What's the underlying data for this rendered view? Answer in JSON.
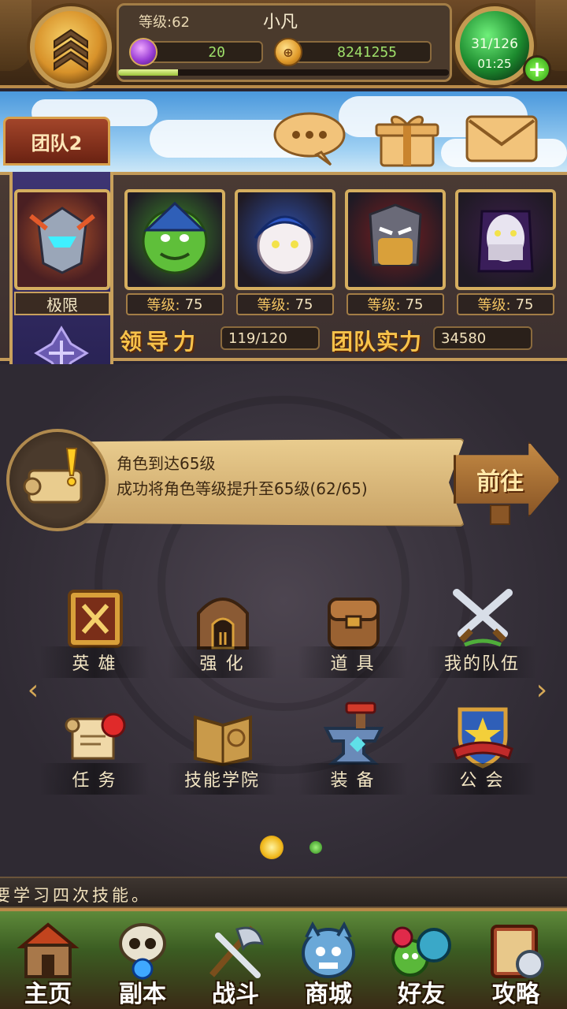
{
  "hud": {
    "level_label": "等级:62",
    "player_name": "小凡",
    "gems": "20",
    "gold": "8241255",
    "gold_icon_glyph": "⊕",
    "exp_fraction": 0.18,
    "energy": "31/126",
    "energy_timer": "01:25",
    "add_glyph": "+"
  },
  "team": {
    "tab_label": "团队2",
    "leader_tag": "极限",
    "heroes": [
      {
        "level_label": "等级:",
        "level": "75",
        "color": "#3c8b2a"
      },
      {
        "level_label": "等级:",
        "level": "75",
        "color": "#2f4fa8"
      },
      {
        "level_label": "等级:",
        "level": "75",
        "color": "#7a1f1f"
      },
      {
        "level_label": "等级:",
        "level": "75",
        "color": "#3b1e4a"
      }
    ],
    "leadership_label": "领导力",
    "leadership_value": "119/120",
    "power_label": "团队实力",
    "power_value": "34580"
  },
  "quest": {
    "title": "角色到达65级",
    "desc": "成功将角色等级提升至65级(62/65)",
    "go_label": "前往"
  },
  "menu": [
    {
      "label": "英 雄",
      "icon": "hero-book-icon"
    },
    {
      "label": "强 化",
      "icon": "forge-icon"
    },
    {
      "label": "道 具",
      "icon": "backpack-icon"
    },
    {
      "label": "我的队伍",
      "icon": "crossed-swords-icon"
    },
    {
      "label": "任 务",
      "icon": "scroll-icon"
    },
    {
      "label": "技能学院",
      "icon": "spellbook-icon"
    },
    {
      "label": "装 备",
      "icon": "anvil-icon"
    },
    {
      "label": "公 会",
      "icon": "guild-shield-icon"
    }
  ],
  "arrows": {
    "left": "‹",
    "right": "›"
  },
  "ticker": "要学习四次技能。",
  "nav": [
    {
      "label": "主页",
      "icon": "home-icon"
    },
    {
      "label": "副本",
      "icon": "dungeon-skull-icon"
    },
    {
      "label": "战斗",
      "icon": "battle-axe-icon"
    },
    {
      "label": "商城",
      "icon": "shop-monster-icon"
    },
    {
      "label": "好友",
      "icon": "friends-icon"
    },
    {
      "label": "攻略",
      "icon": "guide-book-icon"
    }
  ],
  "colors": {
    "accent_gold": "#f7c24a",
    "resource_green": "#9fe06a"
  }
}
